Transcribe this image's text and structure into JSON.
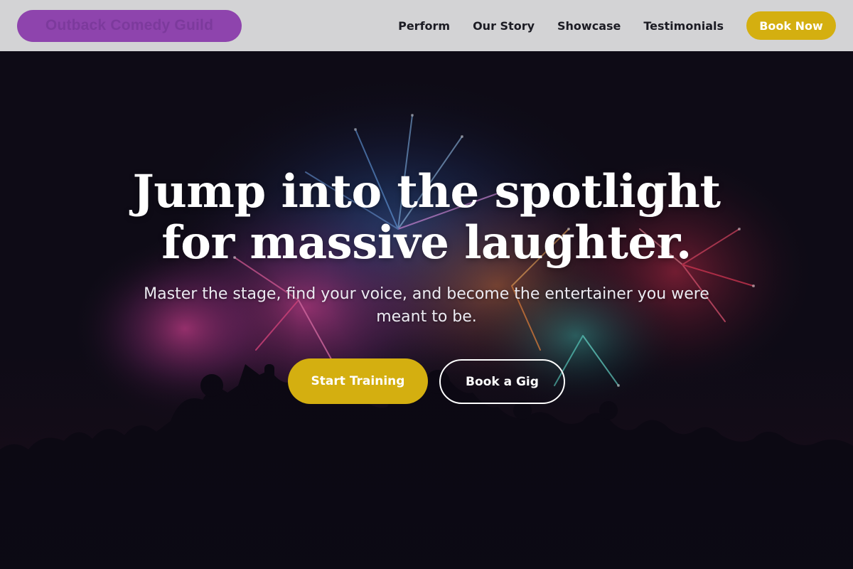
{
  "brand": {
    "name": "Outback Comedy Guild"
  },
  "nav": {
    "links": [
      "Perform",
      "Our Story",
      "Showcase",
      "Testimonials"
    ],
    "cta_label": "Book Now"
  },
  "hero": {
    "title_line1": "Jump into the spotlight",
    "title_line2": "for massive laughter.",
    "subtitle": "Master the stage, find your voice, and become the entertainer you were meant to be.",
    "primary_cta": "Start Training",
    "secondary_cta": "Book a Gig",
    "background_image": "crowd-silhouette-fireworks"
  },
  "colors": {
    "header_bg": "#d3d3d5",
    "logo_pill": "#8e44ad",
    "accent": "#d4af10",
    "hero_bg": "#0e0b16",
    "nav_text": "#1c1c24"
  }
}
